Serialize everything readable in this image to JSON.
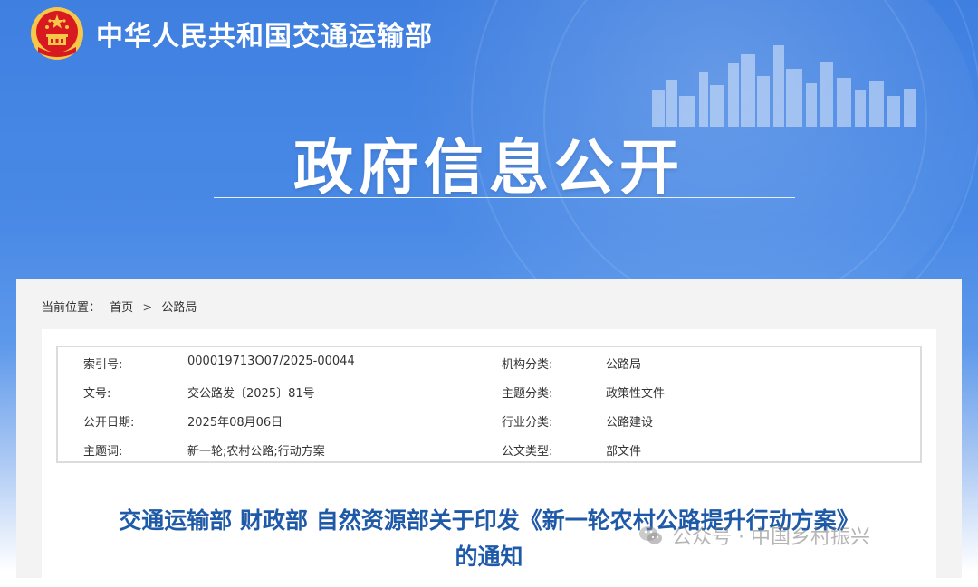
{
  "header": {
    "ministry_name": "中华人民共和国交通运输部",
    "section_title": "政府信息公开"
  },
  "breadcrumb": {
    "label": "当前位置：",
    "items": [
      "首页",
      "公路局"
    ],
    "separator": ">"
  },
  "meta": {
    "rows": [
      {
        "label1": "索引号:",
        "value1": "000019713O07/2025-00044",
        "label2": "机构分类:",
        "value2": "公路局"
      },
      {
        "label1": "文号:",
        "value1": "交公路发〔2025〕81号",
        "label2": "主题分类:",
        "value2": "政策性文件"
      },
      {
        "label1": "公开日期:",
        "value1": "2025年08月06日",
        "label2": "行业分类:",
        "value2": "公路建设"
      },
      {
        "label1": "主题词:",
        "value1": "新一轮;农村公路;行动方案",
        "label2": "公文类型:",
        "value2": "部文件"
      }
    ]
  },
  "document": {
    "title_line1": "交通运输部 财政部 自然资源部关于印发《新一轮农村公路提升行动方案》",
    "title_line2": "的通知"
  },
  "watermark": {
    "text": "公众号 · 中国乡村振兴"
  },
  "colors": {
    "banner_blue": "#3f7fe0",
    "title_blue": "#1f5aa8",
    "emblem_red": "#d8191f",
    "emblem_gold": "#f7c74a"
  }
}
